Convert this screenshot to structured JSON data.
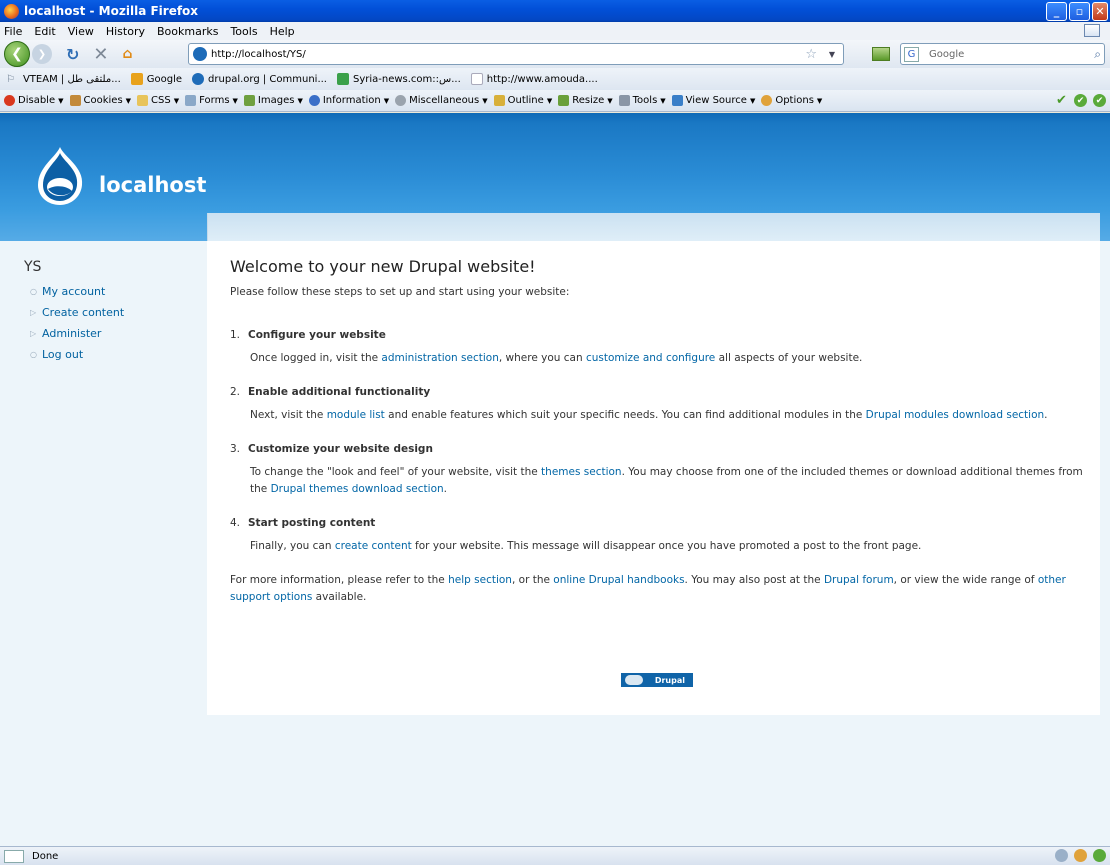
{
  "window": {
    "title": "localhost - Mozilla Firefox"
  },
  "menu": [
    "File",
    "Edit",
    "View",
    "History",
    "Bookmarks",
    "Tools",
    "Help"
  ],
  "nav": {
    "url": "http://localhost/YS/",
    "search_placeholder": "Google",
    "search_engine_icon": "G"
  },
  "bookmarks": [
    {
      "label": "VTEAM | ملتقى طل...",
      "icon_color": "#3a6fb0"
    },
    {
      "label": "Google",
      "icon_color": "#e8a21c"
    },
    {
      "label": "drupal.org | Communi...",
      "icon_color": "#1d6bb8"
    },
    {
      "label": "Syria-news.com::س...",
      "icon_color": "#3aa04a"
    },
    {
      "label": "http://www.amouda....",
      "icon_color": "#d8dde4"
    }
  ],
  "devtoolbar": [
    {
      "label": "Disable",
      "icon_color": "#d9381e"
    },
    {
      "label": "Cookies",
      "icon_color": "#c38a3a"
    },
    {
      "label": "CSS",
      "icon_color": "#e8c45a"
    },
    {
      "label": "Forms",
      "icon_color": "#8aa8c8"
    },
    {
      "label": "Images",
      "icon_color": "#6fa03f"
    },
    {
      "label": "Information",
      "icon_color": "#3a6fc8"
    },
    {
      "label": "Miscellaneous",
      "icon_color": "#9aa3ad"
    },
    {
      "label": "Outline",
      "icon_color": "#d8b03a"
    },
    {
      "label": "Resize",
      "icon_color": "#6aa03a"
    },
    {
      "label": "Tools",
      "icon_color": "#8a96a6"
    },
    {
      "label": "View Source",
      "icon_color": "#3a7fc8"
    },
    {
      "label": "Options",
      "icon_color": "#e0a23a"
    }
  ],
  "site": {
    "name": "localhost"
  },
  "sidebar": {
    "title": "YS",
    "items": [
      "My account",
      "Create content",
      "Administer",
      "Log out"
    ]
  },
  "content": {
    "heading": "Welcome to your new Drupal website!",
    "intro": "Please follow these steps to set up and start using your website:",
    "steps": [
      {
        "num": "1.",
        "title": "Configure your website",
        "parts": [
          "Once logged in, visit the ",
          "administration section",
          ", where you can ",
          "customize and configure",
          " all aspects of your website."
        ]
      },
      {
        "num": "2.",
        "title": "Enable additional functionality",
        "parts": [
          "Next, visit the ",
          "module list",
          " and enable features which suit your specific needs. You can find additional modules in the ",
          "Drupal modules download section",
          "."
        ]
      },
      {
        "num": "3.",
        "title": "Customize your website design",
        "parts": [
          "To change the \"look and feel\" of your website, visit the ",
          "themes section",
          ". You may choose from one of the included themes or download additional themes from the ",
          "Drupal themes download section",
          "."
        ]
      },
      {
        "num": "4.",
        "title": "Start posting content",
        "parts": [
          "Finally, you can ",
          "create content",
          " for your website. This message will disappear once you have promoted a post to the front page."
        ]
      }
    ],
    "more_parts": [
      "For more information, please refer to the ",
      "help section",
      ", or the ",
      "online Drupal handbooks",
      ". You may also post at the ",
      "Drupal forum",
      ", or view the wide range of ",
      "other support options",
      " available."
    ],
    "powered_label": "Drupal"
  },
  "status": {
    "text": "Done"
  },
  "colors": {
    "header_blue": "#2b8dd6",
    "link": "#0266a6"
  }
}
